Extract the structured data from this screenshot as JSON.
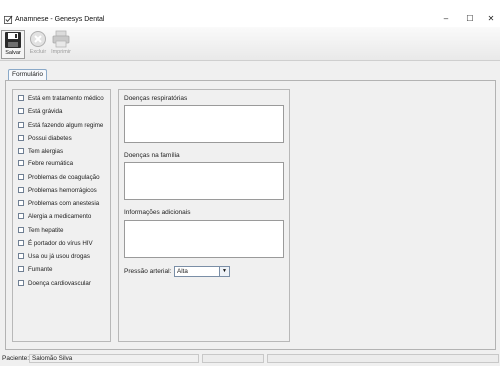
{
  "window": {
    "title": "Anamnese - Genesys Dental",
    "minimize_glyph": "–",
    "maximize_glyph": "☐",
    "close_glyph": "✕"
  },
  "toolbar": {
    "save_label": "Salvar",
    "delete_label": "Excluir",
    "print_label": "Imprimir"
  },
  "tab": {
    "label": "Formulário"
  },
  "conditions": [
    "Está em tratamento médico",
    "Está grávida",
    "Está fazendo algum regime",
    "Possui diabetes",
    "Tem alergias",
    "Febre reumática",
    "Problemas de coagulação",
    "Problemas hemorrágicos",
    "Problemas com anestesia",
    "Alergia a medicamento",
    "Tem hepatite",
    "É portador do vírus HIV",
    "Usa ou já usou drogas",
    "Fumante",
    "Doença cardiovascular"
  ],
  "fields": {
    "respiratory_label": "Doenças respiratórias",
    "respiratory_value": "",
    "family_label": "Doenças na família",
    "family_value": "",
    "additional_label": "Informações adicionais",
    "additional_value": ""
  },
  "pressure": {
    "label": "Pressão arterial:",
    "value": "Alta",
    "arrow": "▼"
  },
  "status": {
    "patient_label": "Paciente:",
    "patient_name": "Salomão Silva"
  },
  "icons": {
    "app": "checklist-icon",
    "save": "floppy-disk-icon",
    "delete": "delete-x-icon",
    "print": "printer-icon"
  },
  "colors": {
    "tab_border": "#8aa9c8",
    "field_border": "#9a9a9a",
    "disabled_text": "#9c9c9c"
  }
}
